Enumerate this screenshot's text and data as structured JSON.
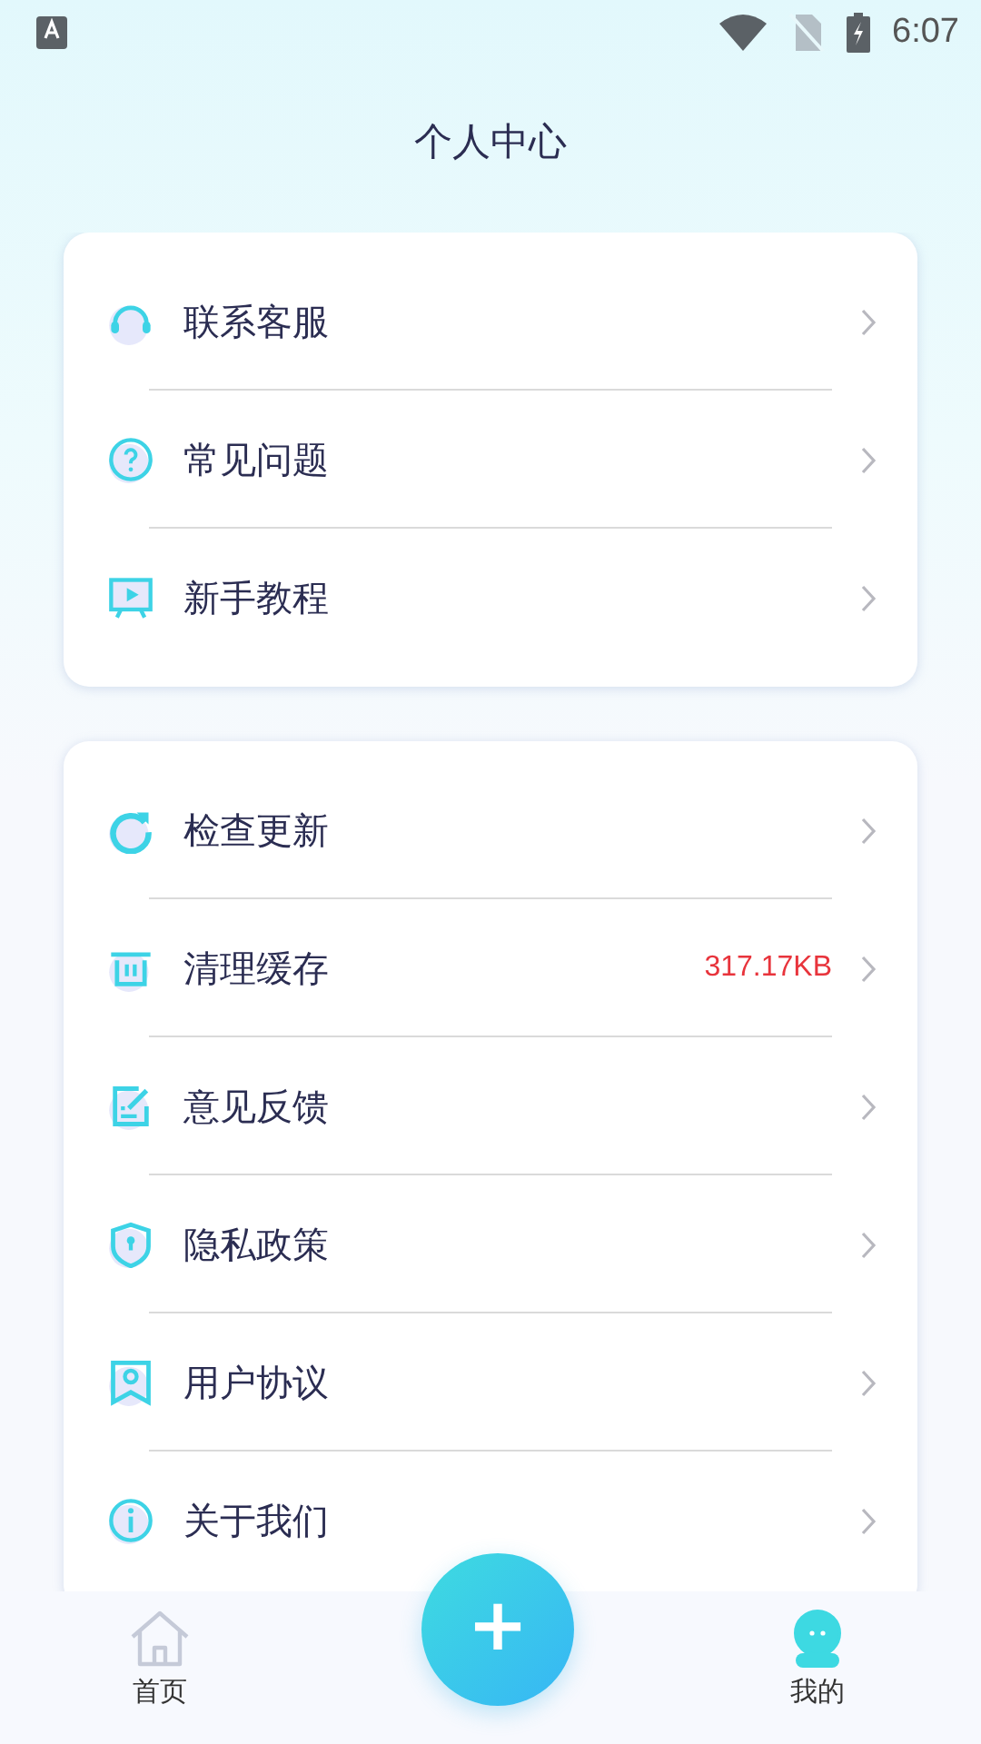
{
  "status_bar": {
    "time": "6:07"
  },
  "header": {
    "title": "个人中心"
  },
  "sections": [
    {
      "items": [
        {
          "label": "联系客服"
        },
        {
          "label": "常见问题"
        },
        {
          "label": "新手教程"
        }
      ]
    },
    {
      "items": [
        {
          "label": "检查更新"
        },
        {
          "label": "清理缓存",
          "value": "317.17KB"
        },
        {
          "label": "意见反馈"
        },
        {
          "label": "隐私政策"
        },
        {
          "label": "用户协议"
        },
        {
          "label": "关于我们"
        }
      ]
    }
  ],
  "bottom_nav": {
    "tabs": [
      {
        "label": "首页",
        "selected": false
      },
      {
        "label": "我的",
        "selected": true
      }
    ],
    "fab": {
      "label": "+"
    }
  }
}
